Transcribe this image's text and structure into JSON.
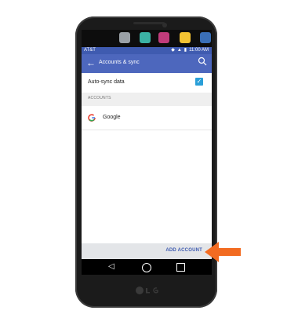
{
  "status_bar": {
    "carrier": "AT&T",
    "time": "11:00 AM"
  },
  "app_bar": {
    "title": "Accounts & sync",
    "back_icon": "arrow-left-icon",
    "search_icon": "search-icon"
  },
  "settings": {
    "auto_sync_label": "Auto-sync data",
    "auto_sync_checked": true,
    "section_header": "ACCOUNTS",
    "accounts": [
      {
        "label": "Google",
        "icon": "google-icon"
      }
    ]
  },
  "bottom_bar": {
    "add_account_label": "ADD ACCOUNT"
  },
  "nav_bar": {
    "back_icon": "triangle-back-icon",
    "home_icon": "circle-home-icon",
    "recent_icon": "square-recent-icon"
  },
  "dock_apps": [
    {
      "name": "camera-app-icon",
      "color": "#9aa0a6"
    },
    {
      "name": "contacts-app-icon",
      "color": "#3bb1a4"
    },
    {
      "name": "messaging-app-icon",
      "color": "#c03c7b"
    },
    {
      "name": "notes-app-icon",
      "color": "#f3c232"
    },
    {
      "name": "gallery-app-icon",
      "color": "#3a6fb7"
    }
  ],
  "colors": {
    "accent": "#4d67bd",
    "status": "#3f5bb0",
    "checkbox": "#2a9fd8",
    "arrow": "#f26b21"
  }
}
